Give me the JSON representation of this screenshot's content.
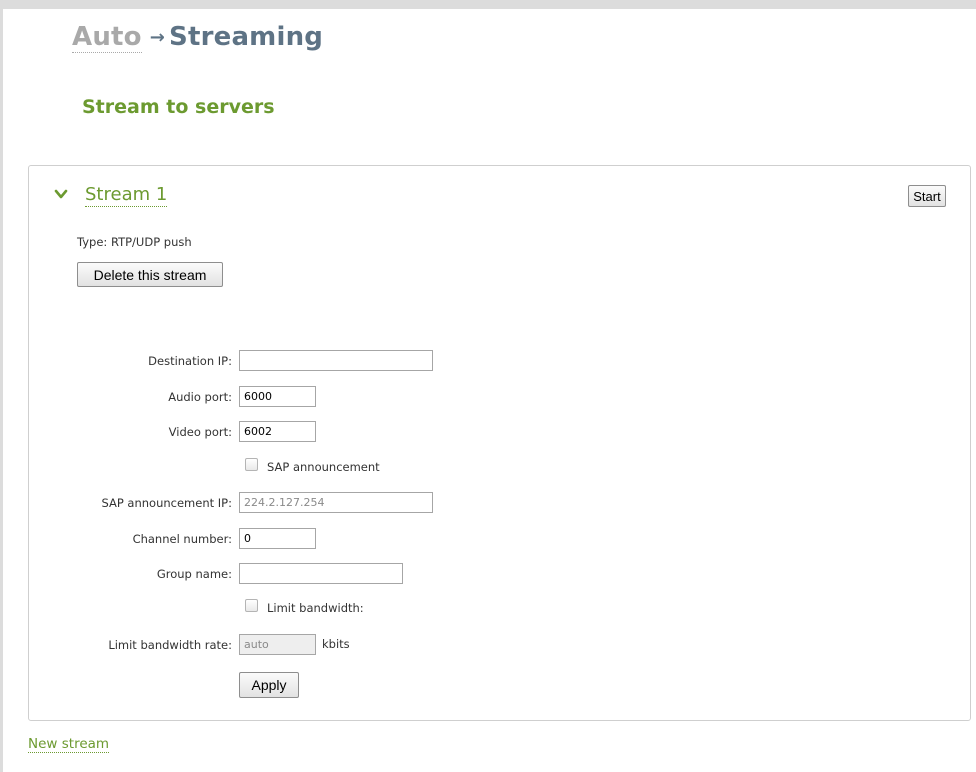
{
  "breadcrumb": {
    "parent": "Auto",
    "separator": "→",
    "current": "Streaming"
  },
  "section_title": "Stream to servers",
  "stream": {
    "title": "Stream 1",
    "start_label": "Start",
    "type_text": "Type: RTP/UDP push",
    "delete_label": "Delete this stream",
    "expanded": true
  },
  "form": {
    "destination_ip": {
      "label": "Destination IP:",
      "value": ""
    },
    "audio_port": {
      "label": "Audio port:",
      "value": "6000"
    },
    "video_port": {
      "label": "Video port:",
      "value": "6002"
    },
    "sap_announcement": {
      "label": "SAP announcement",
      "checked": false
    },
    "sap_announcement_ip": {
      "label": "SAP announcement IP:",
      "value": "224.2.127.254"
    },
    "channel_number": {
      "label": "Channel number:",
      "value": "0"
    },
    "group_name": {
      "label": "Group name:",
      "value": ""
    },
    "limit_bandwidth": {
      "label": "Limit bandwidth:",
      "checked": false
    },
    "limit_bandwidth_rate": {
      "label": "Limit bandwidth rate:",
      "value": "auto",
      "unit": "kbits"
    },
    "apply_label": "Apply"
  },
  "new_stream_label": "New stream",
  "colors": {
    "accent_green": "#6c9a30",
    "heading_slate": "#5e7385",
    "muted_gray": "#a9a9a9"
  },
  "icons": {
    "expand": "chevron-down-icon"
  }
}
